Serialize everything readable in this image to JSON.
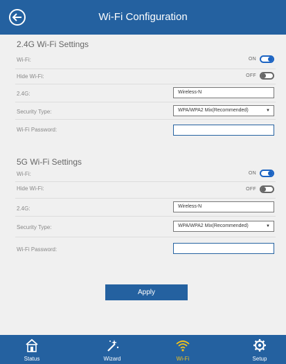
{
  "header": {
    "title": "Wi-Fi Configuration",
    "back_icon": "back-arrow-icon"
  },
  "sections": [
    {
      "title": "2.4G Wi-Fi Settings",
      "wifi": {
        "label": "Wi-Fi:",
        "state": "ON"
      },
      "hide": {
        "label": "Hide Wi-Fi:",
        "state": "OFF"
      },
      "ssid": {
        "label": "2.4G:",
        "value": "Wireless-N"
      },
      "security": {
        "label": "Security Type:",
        "value": "WPA/WPA2 Mix(Recommended)"
      },
      "password": {
        "label": "Wi-Fi Password:",
        "value": ""
      }
    },
    {
      "title": "5G Wi-Fi Settings",
      "wifi": {
        "label": "Wi-Fi:",
        "state": "ON"
      },
      "hide": {
        "label": "Hide Wi-Fi:",
        "state": "OFF"
      },
      "ssid": {
        "label": "2.4G:",
        "value": "Wireless-N"
      },
      "security": {
        "label": "Security Type:",
        "value": "WPA/WPA2 Mix(Recommended)"
      },
      "password": {
        "label": "Wi-Fi Password:",
        "value": ""
      }
    }
  ],
  "apply_label": "Apply",
  "nav": [
    {
      "label": "Status",
      "icon": "home-icon"
    },
    {
      "label": "Wizard",
      "icon": "magic-wand-icon"
    },
    {
      "label": "Wi-Fi",
      "icon": "wifi-icon",
      "active": true
    },
    {
      "label": "Setup",
      "icon": "gear-icon"
    }
  ],
  "colors": {
    "primary": "#2461a0",
    "active_nav": "#f2c21b",
    "toggle_on": "#1b63c2"
  }
}
